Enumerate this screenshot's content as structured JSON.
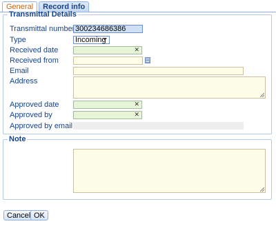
{
  "tabs": [
    {
      "label": "General"
    },
    {
      "label": "Record info"
    }
  ],
  "transmittal": {
    "legend": "Transmittal Details",
    "number_label": "Transmittal number",
    "number_value": "300234686386",
    "type_label": "Type",
    "type_value": "Incoming",
    "received_date_label": "Received date",
    "received_date_value": "",
    "received_from_label": "Received from",
    "received_from_value": "",
    "email_label": "Email",
    "email_value": "",
    "address_label": "Address",
    "address_value": "",
    "approved_date_label": "Approved date",
    "approved_date_value": "",
    "approved_by_label": "Approved by",
    "approved_by_value": "",
    "approved_by_email_label": "Approved by email",
    "clear_glyph": "✕"
  },
  "note": {
    "legend": "Note",
    "value": ""
  },
  "buttons": {
    "cancel": "Cancel",
    "ok": "OK"
  }
}
